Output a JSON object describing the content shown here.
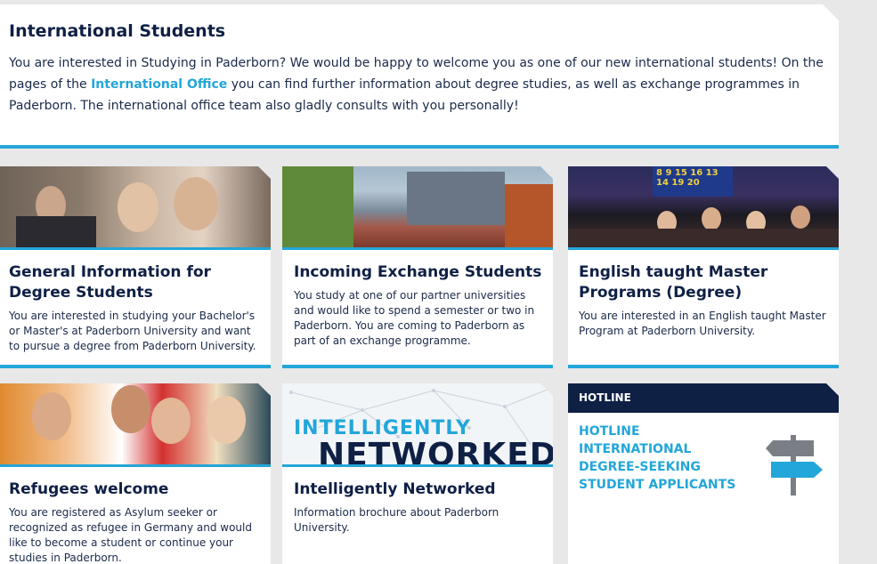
{
  "intro": {
    "title": "International Students",
    "text_before": "You are interested in Studying in Paderborn? We would be happy to welcome you as one of our new international students! On the pages of the ",
    "link": "International Office",
    "text_after": "  you can find further information about degree studies, as well as exchange programmes in Paderborn. The international office team also gladly consults with you personally!"
  },
  "cards": [
    {
      "title": "General Information for Degree Students",
      "text": "You are interested in studying your Bachelor's or Master's at Paderborn University and want to pursue a degree from Paderborn University."
    },
    {
      "title": "Incoming Exchange Students",
      "text": "You study at one of our partner universities and would like to spend a semester or two in Paderborn. You are coming to Paderborn as part of an exchange programme."
    },
    {
      "title": "English taught Master Programs (Degree)",
      "text": "You are interested in an English taught Master Program at Paderborn University."
    },
    {
      "title": "Refugees welcome",
      "text": "You are registered as Asylum seeker or recognized as refugee in Germany and would like to become a student or continue your studies in Paderborn."
    },
    {
      "title": "Intelligently Networked",
      "text": "Information brochure about Paderborn University.",
      "image_line1": "INTELLIGENTLY",
      "image_line2": "NETWORKED"
    }
  ],
  "hotline": {
    "header": "HOTLINE",
    "lines": [
      "HOTLINE",
      "INTERNATIONAL",
      "DEGREE-SEEKING",
      "STUDENT APPLICANTS"
    ]
  },
  "auditorium_numbers": "8 9 15 16 13 14 19 20",
  "colors": {
    "accent": "#23a6d9",
    "navy": "#0f2045",
    "background": "#e8e8e8"
  }
}
